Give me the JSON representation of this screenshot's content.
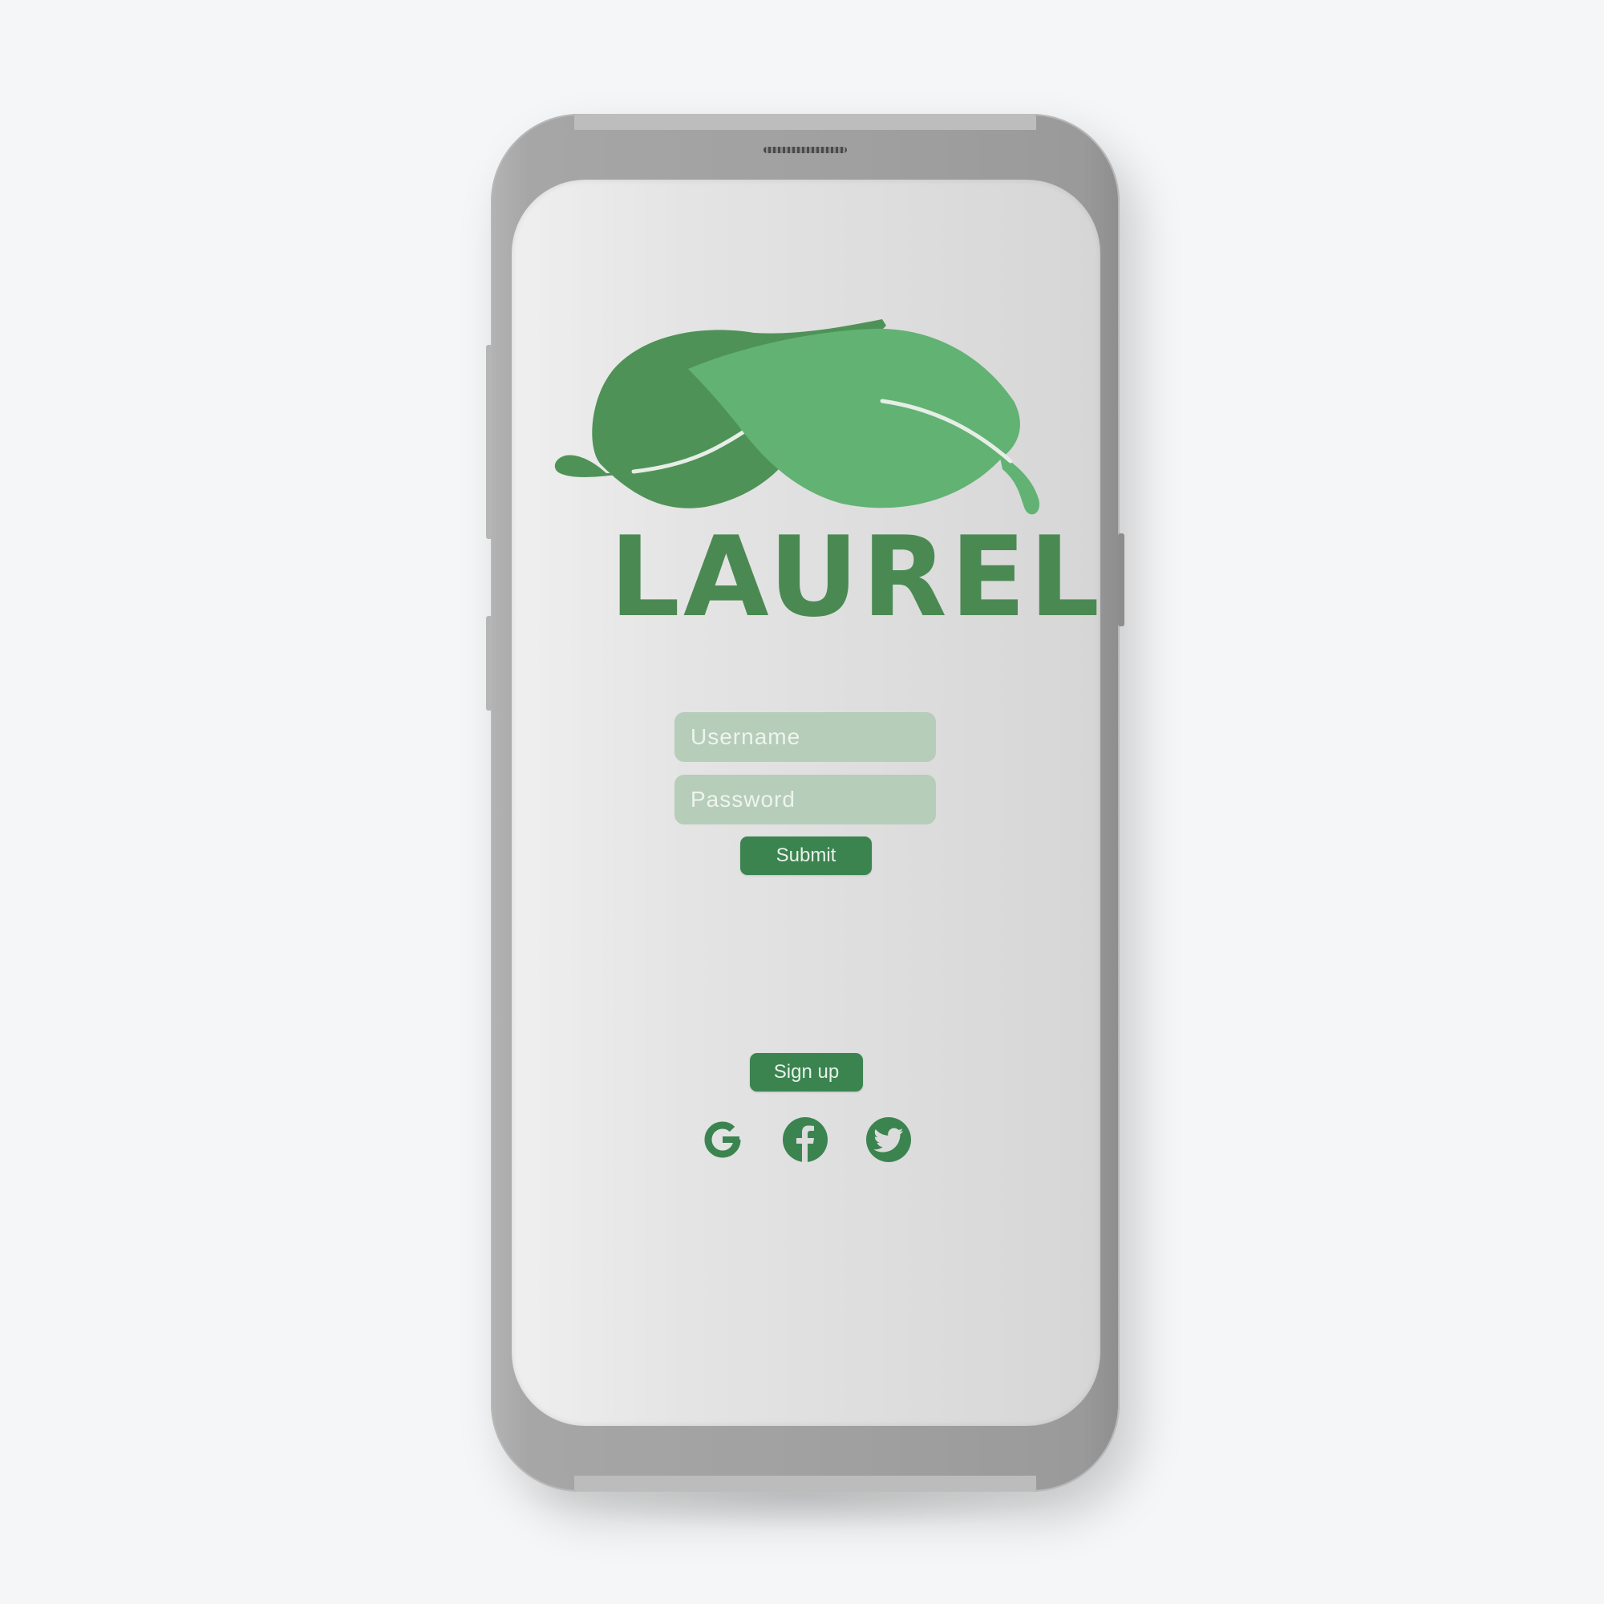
{
  "app": {
    "brand_name": "LAUREL",
    "logo_icon": "laurel-leaves-icon"
  },
  "login": {
    "username_placeholder": "Username",
    "password_placeholder": "Password",
    "submit_label": "Submit"
  },
  "signup": {
    "label": "Sign up"
  },
  "social_logins": [
    {
      "icon": "google-icon"
    },
    {
      "icon": "facebook-icon"
    },
    {
      "icon": "twitter-icon"
    }
  ],
  "colors": {
    "brand_green": "#4a8a52",
    "button_green": "#3b8450",
    "input_fill": "#b6cdb9",
    "leaf_dark": "#4f9257",
    "leaf_light": "#62b274"
  }
}
